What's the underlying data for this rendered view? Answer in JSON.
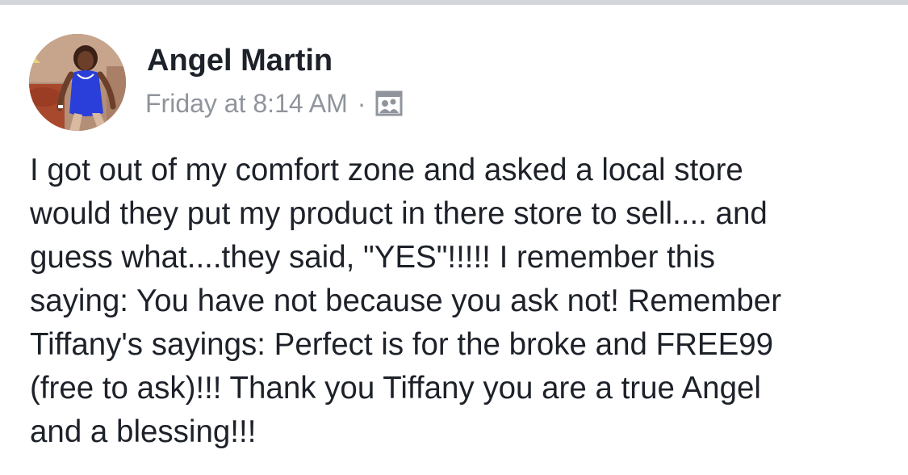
{
  "post": {
    "author": {
      "name": "Angel Martin",
      "avatar_icon": "user-avatar-photo"
    },
    "timestamp": "Friday at 8:14 AM",
    "separator": "·",
    "privacy_icon": "friends-audience-icon",
    "body": "I got out of my comfort zone and asked a local store\nwould they put my product in there store to sell.... and\nguess what....they said, \"YES\"!!!!!  I remember this\nsaying: You have not because you ask not! Remember\nTiffany's sayings: Perfect is for the broke and FREE99\n(free to ask)!!! Thank you Tiffany you are a true Angel\nand a blessing!!!"
  },
  "colors": {
    "text_primary": "#1d2129",
    "text_secondary": "#90949c",
    "top_border": "#d3d6db",
    "background": "#ffffff"
  }
}
